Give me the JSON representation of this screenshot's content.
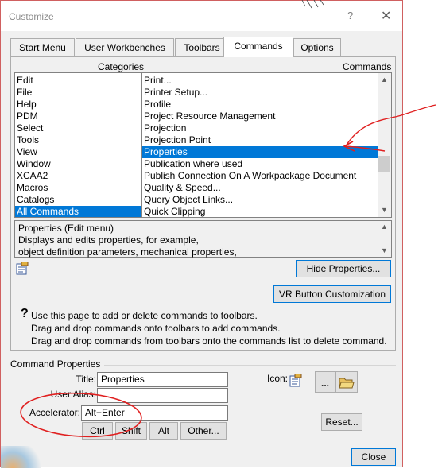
{
  "window": {
    "title": "Customize",
    "help": "?",
    "close": "✕"
  },
  "tabs": [
    {
      "label": "Start Menu",
      "active": false
    },
    {
      "label": "User Workbenches",
      "active": false
    },
    {
      "label": "Toolbars",
      "active": false
    },
    {
      "label": "Commands",
      "active": true
    },
    {
      "label": "Options",
      "active": false
    }
  ],
  "categories": {
    "header": "Categories",
    "items": [
      "Edit",
      "File",
      "Help",
      "PDM",
      "Select",
      "Tools",
      "View",
      "Window",
      "XCAA2",
      "Macros",
      "Catalogs",
      "All Commands"
    ],
    "selected": "All Commands"
  },
  "commands": {
    "header": "Commands",
    "items": [
      "Print...",
      "Printer Setup...",
      "Profile",
      "Project Resource Management",
      "Projection",
      "Projection Point",
      "Properties",
      "Publication where used",
      "Publish Connection On A Workpackage Document",
      "Quality & Speed...",
      "Query Object Links...",
      "Quick Clipping"
    ],
    "selected": "Properties"
  },
  "description": {
    "lines": [
      "Properties (Edit menu)",
      "Displays and edits properties, for example,",
      "object definition parameters, mechanical properties,"
    ]
  },
  "buttons": {
    "hide_properties": "Hide Properties...",
    "vr_customization": "VR Button Customization",
    "browse": "...",
    "reset": "Reset...",
    "close": "Close",
    "ctrl": "Ctrl",
    "shift": "Shift",
    "alt": "Alt",
    "other": "Other..."
  },
  "info": {
    "lines": [
      "Use this page to add or delete commands to toolbars.",
      "Drag and drop commands onto toolbars to add commands.",
      "Drag and drop commands from toolbars onto the commands list to delete command."
    ]
  },
  "command_properties": {
    "group_label": "Command Properties",
    "title_label": "Title:",
    "title_value": "Properties",
    "alias_label": "User Alias:",
    "alias_value": "",
    "accelerator_label": "Accelerator:",
    "accelerator_value": "Alt+Enter",
    "icon_label": "Icon:"
  },
  "icons": {
    "properties": "properties-icon",
    "help": "question-icon",
    "folder": "folder-icon"
  },
  "colors": {
    "selection": "#0078d7",
    "annotation": "#e02020"
  }
}
